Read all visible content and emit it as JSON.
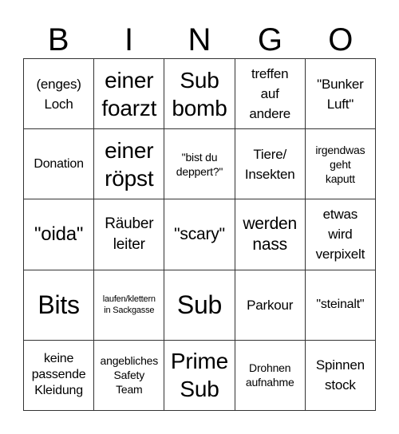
{
  "header": {
    "letters": [
      "B",
      "I",
      "N",
      "G",
      "O"
    ]
  },
  "board": {
    "rows": [
      [
        "(enges)\nLoch",
        "einer\nfoarzt",
        "Sub\nbomb",
        "treffen\nauf\nandere",
        "\"Bunker\nLuft\""
      ],
      [
        "Donation",
        "einer\nröpst",
        "\"bist du\ndeppert?\"",
        "Tiere/\nInsekten",
        "irgendwas\ngeht\nkaputt"
      ],
      [
        "\"oida\"",
        "Räuber\nleiter",
        "\"scary\"",
        "werden\nnass",
        "etwas\nwird\nverpixelt"
      ],
      [
        "Bits",
        "laufen/klettern\nin Sackgasse",
        "Sub",
        "Parkour",
        "\"steinalt\""
      ],
      [
        "keine\npassende\nKleidung",
        "angebliches\nSafety\nTeam",
        "Prime\nSub",
        "Drohnen\naufnahme",
        "Spinnen\nstock"
      ]
    ]
  }
}
